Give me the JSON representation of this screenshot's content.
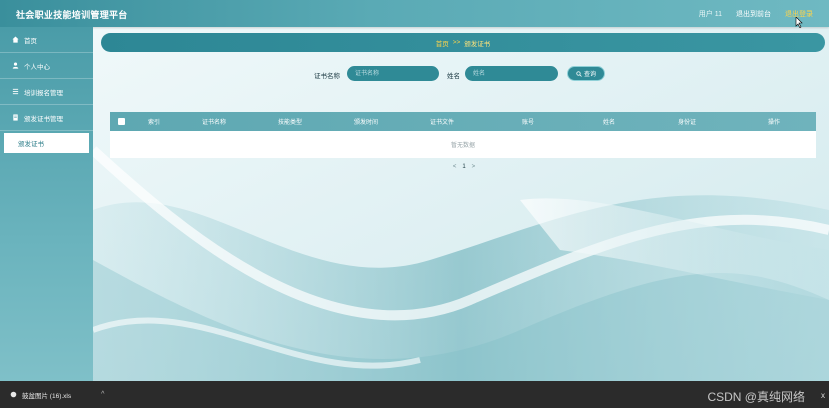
{
  "app": {
    "title": "社会职业技能培训管理平台"
  },
  "topbar": {
    "user": "用户 11",
    "exit_system": "退出到前台",
    "logout": "退出登录"
  },
  "sidebar": {
    "items": [
      {
        "label": "首页",
        "icon": "home-icon"
      },
      {
        "label": "个人中心",
        "icon": "user-icon"
      },
      {
        "label": "培训报名管理",
        "icon": "list-icon"
      },
      {
        "label": "颁发证书管理",
        "icon": "doc-icon"
      }
    ],
    "subitem": "颁发证书"
  },
  "breadcrumb": {
    "home": "首页",
    "sep": ">>",
    "current": "颁发证书"
  },
  "search": {
    "label1": "证书名称",
    "placeholder1": "证书名称",
    "label2": "姓名",
    "placeholder2": "姓名",
    "button": "查询"
  },
  "table": {
    "columns": [
      "索引",
      "证书名称",
      "技能类型",
      "颁发时间",
      "证书文件",
      "账号",
      "姓名",
      "身份证",
      "操作"
    ],
    "empty_text": "暂无数据"
  },
  "pagination": {
    "prev": "<",
    "page": "1",
    "next": ">"
  },
  "download_bar": {
    "file": "鼓盆图片 (16).xls",
    "chevron": "^",
    "watermark": "CSDN @真纯网络",
    "close": "x"
  },
  "colors": {
    "accent": "#2f8a96",
    "highlight": "#ffd54a"
  }
}
